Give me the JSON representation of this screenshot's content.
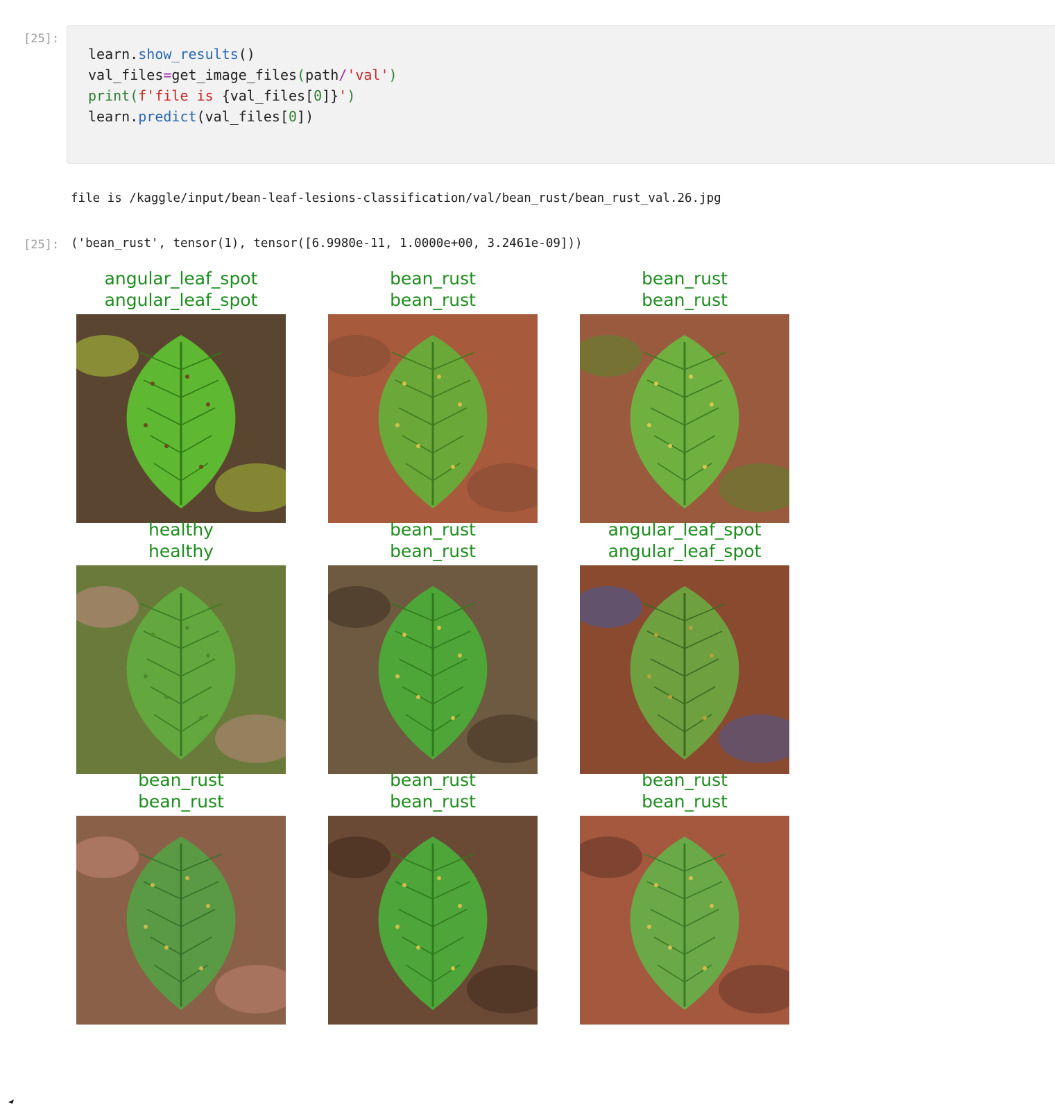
{
  "cells": [
    {
      "prompt": "[25]:",
      "code_lines": [
        [
          [
            "learn.",
            ""
          ],
          [
            "show_results",
            "fn"
          ],
          [
            "()",
            ""
          ]
        ],
        [
          [
            "val_files",
            ""
          ],
          [
            "=",
            "op"
          ],
          [
            "get_image_files",
            ""
          ],
          [
            "(",
            "p"
          ],
          [
            "path",
            ""
          ],
          [
            "/",
            "op"
          ],
          [
            "'val'",
            "str"
          ],
          [
            ")",
            "p"
          ]
        ],
        [
          [
            "print",
            "kw"
          ],
          [
            "(",
            "p"
          ],
          [
            "f'file is ",
            "str"
          ],
          [
            "{val_files[",
            "",
            ""
          ],
          [
            "0",
            "num"
          ],
          [
            "]}",
            "",
            ""
          ],
          [
            "'",
            "str"
          ],
          [
            ")",
            "p"
          ]
        ],
        [
          [
            "learn.",
            ""
          ],
          [
            "predict",
            "fn"
          ],
          [
            "(val_files[",
            ""
          ],
          [
            "0",
            "num"
          ],
          [
            "])",
            ""
          ]
        ]
      ]
    }
  ],
  "output": {
    "stdout": "file is /kaggle/input/bean-leaf-lesions-classification/val/bean_rust/bean_rust_val.26.jpg",
    "result_prompt": "[25]:",
    "result_text": "('bean_rust', tensor(1), tensor([6.9980e-11, 1.0000e+00, 3.2461e-09]))"
  },
  "results_grid": [
    {
      "actual": "angular_leaf_spot",
      "predicted": "angular_leaf_spot",
      "image": "leaf-photo-angular-leaf-spot"
    },
    {
      "actual": "bean_rust",
      "predicted": "bean_rust",
      "image": "leaf-photo-bean-rust-hand"
    },
    {
      "actual": "bean_rust",
      "predicted": "bean_rust",
      "image": "leaf-photo-bean-rust"
    },
    {
      "actual": "healthy",
      "predicted": "healthy",
      "image": "leaf-photo-healthy"
    },
    {
      "actual": "bean_rust",
      "predicted": "bean_rust",
      "image": "leaf-photo-bean-rust-plant"
    },
    {
      "actual": "angular_leaf_spot",
      "predicted": "angular_leaf_spot",
      "image": "leaf-photo-angular-leaf-spot-field"
    },
    {
      "actual": "bean_rust",
      "predicted": "bean_rust",
      "image": "leaf-photo-bean-rust-soil"
    },
    {
      "actual": "bean_rust",
      "predicted": "bean_rust",
      "image": "leaf-photo-bean-rust-hand-2"
    },
    {
      "actual": "bean_rust",
      "predicted": "bean_rust",
      "image": "leaf-photo-bean-rust-soil-2"
    }
  ],
  "colors": {
    "label_green": "#1e8c1e",
    "code_bg": "#f2f2f2",
    "prompt_gray": "#9a9a9a"
  }
}
